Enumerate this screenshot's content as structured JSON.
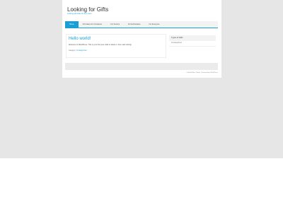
{
  "site": {
    "title": "Looking for Gifts",
    "description": "Looking gift ideas for any event"
  },
  "nav": {
    "items": [
      {
        "label": "Home",
        "active": true
      },
      {
        "label": "Gift Ideas For Occasions",
        "active": false
      },
      {
        "label": "For Seniors",
        "active": false
      },
      {
        "label": "For Enthusiasts",
        "active": false
      },
      {
        "label": "For Everyone",
        "active": false
      }
    ]
  },
  "post": {
    "title": "Hello world!",
    "body": "Welcome to WordPress. This is your first post. Edit or delete it, then start writing!",
    "meta_prefix": "Category:",
    "category": "Uncategorized"
  },
  "sidebar": {
    "widget_title": "Types of Gifts",
    "items": [
      "Uncategorized"
    ]
  },
  "footer": {
    "credit": "Colorful Blue Theme | Powered by WordPress"
  },
  "colors": {
    "accent": "#18a0d6",
    "outer_background": "#e6e6e6"
  }
}
